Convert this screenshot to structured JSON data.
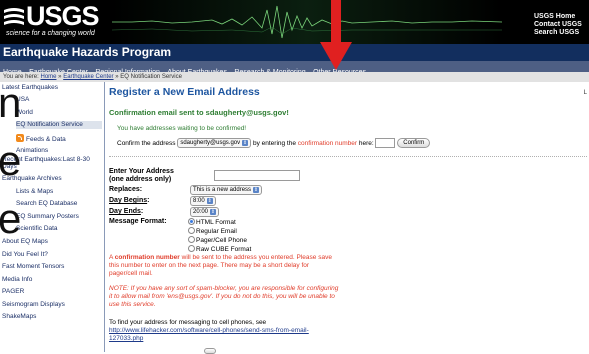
{
  "header": {
    "logo_text": "USGS",
    "logo_tagline": "science for a changing world",
    "top_links": [
      "USGS Home",
      "Contact USGS",
      "Search USGS"
    ],
    "program_title": "Earthquake Hazards Program"
  },
  "nav": {
    "items": [
      "Home",
      "Earthquake Center",
      "Regional Information",
      "About Earthquakes",
      "Research & Monitoring",
      "Other Resources"
    ]
  },
  "breadcrumb": {
    "prefix": "You are here:",
    "home": "Home",
    "sep": "»",
    "center": "Earthquake Center",
    "current": "EQ Notification Service"
  },
  "bleed_text": {
    "line1": "n",
    "line2": "e",
    "line3": "e"
  },
  "sidebar": {
    "items": [
      "Latest Earthquakes",
      "USA",
      "World",
      "EQ Notification Service",
      "Feeds & Data",
      "Animations",
      "Recent Earthquakes:Last 8-30 Days",
      "Earthquake Archives",
      "Lists & Maps",
      "Search EQ Database",
      "EQ Summary Posters",
      "Scientific Data",
      "About EQ Maps",
      "Did You Feel It?",
      "Fast Moment Tensors",
      "Media Info",
      "PAGER",
      "Seismogram Displays",
      "ShakeMaps"
    ]
  },
  "main": {
    "title": "Register a New Email Address",
    "corner_text": "L",
    "confirm_heading": "Confirmation email sent to sdaugherty@usgs.gov!",
    "waiting_text": "You have addresses waiting to be confirmed!",
    "confirm_row": {
      "pre": "Confirm the address",
      "select_value": "sdaugherty@usgs.gov",
      "mid": "by entering the",
      "red": "confirmation number",
      "post": "here:",
      "button": "Confirm"
    },
    "form": {
      "address_label_1": "Enter Your Address",
      "address_label_2": "(one address only)",
      "replaces_label": "Replaces:",
      "replaces_value": "This is a new address",
      "day_begins_label": "Day Begins",
      "day_begins_value": "8:00",
      "day_ends_label": "Day Ends",
      "day_ends_value": "20:00",
      "colon": ":",
      "format_label": "Message Format:",
      "formats": [
        "HTML Format",
        "Regular Email",
        "Pager/Cell Phone",
        "Raw CUBE Format"
      ]
    },
    "notice_pre": "A",
    "notice_bold": "confirmation number",
    "notice_post": "will be sent to the address you entered. Please save this number to enter on the next page. There may be a short delay for pager/cell mail.",
    "spam_note": "NOTE: If you have any sort of spam-blocker, you are responsible for configuring it to allow mail from 'ens@usgs.gov'. If you do not do this, you will be unable to use this service.",
    "cell_intro": "To find your address for messaging to cell phones, see",
    "cell_link": "http://www.lifehacker.com/software/cell-phones/send-sms-from-email-127033.php"
  },
  "colors": {
    "header_bg": "#000000",
    "program_bar": "#122e5e",
    "nav_bar": "#4e5f84",
    "title_blue": "#1e56a0",
    "success_green": "#2e7d32",
    "alert_red": "#e03c2a",
    "annotation_arrow": "#e02020"
  }
}
